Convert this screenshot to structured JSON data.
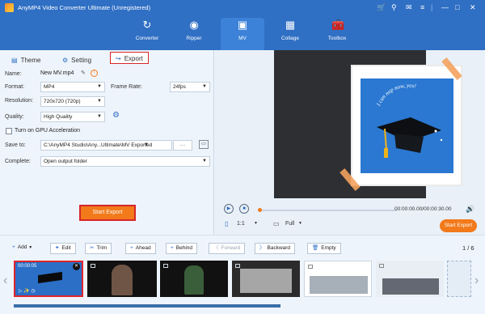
{
  "app": {
    "title": "AnyMP4 Video Converter Ultimate (Unregistered)"
  },
  "nav": [
    {
      "label": "Converter",
      "icon": "converter-icon"
    },
    {
      "label": "Ripper",
      "icon": "ripper-icon"
    },
    {
      "label": "MV",
      "icon": "mv-icon"
    },
    {
      "label": "Collage",
      "icon": "collage-icon"
    },
    {
      "label": "Toolbox",
      "icon": "toolbox-icon"
    }
  ],
  "subtabs": {
    "theme": "Theme",
    "setting": "Setting",
    "export": "Export"
  },
  "form": {
    "name_label": "Name:",
    "name_value": "New MV.mp4",
    "format_label": "Format:",
    "format_value": "MP4",
    "framerate_label": "Frame Rate:",
    "framerate_value": "24fps",
    "resolution_label": "Resolution:",
    "resolution_value": "720x720 (720p)",
    "quality_label": "Quality:",
    "quality_value": "High Quality",
    "gpu_label": "Turn on GPU Acceleration",
    "saveto_label": "Save to:",
    "saveto_value": "C:\\AnyMP4 Studio\\Any...Ultimate\\MV Exported",
    "saveto_more": "···",
    "complete_label": "Complete:",
    "complete_value": "Open output folder",
    "start_export": "Start Export"
  },
  "preview": {
    "card_text": "I can nap now, yes!",
    "timecode": "00:00:00.00/00:00:30.00",
    "ratio": "1:1",
    "fit": "Full",
    "start_export": "Start Export"
  },
  "toolbar": {
    "add": "Add",
    "edit": "Edit",
    "trim": "Trim",
    "ahead": "Ahead",
    "behind": "Behind",
    "forward": "Forward",
    "backward": "Backward",
    "empty": "Empty",
    "page": "1 / 6"
  },
  "timeline": {
    "selected_time": "00:00:05"
  },
  "colors": {
    "brand_blue": "#2f6fc4",
    "accent_orange": "#f27a1a",
    "highlight_red": "#d6262a"
  }
}
